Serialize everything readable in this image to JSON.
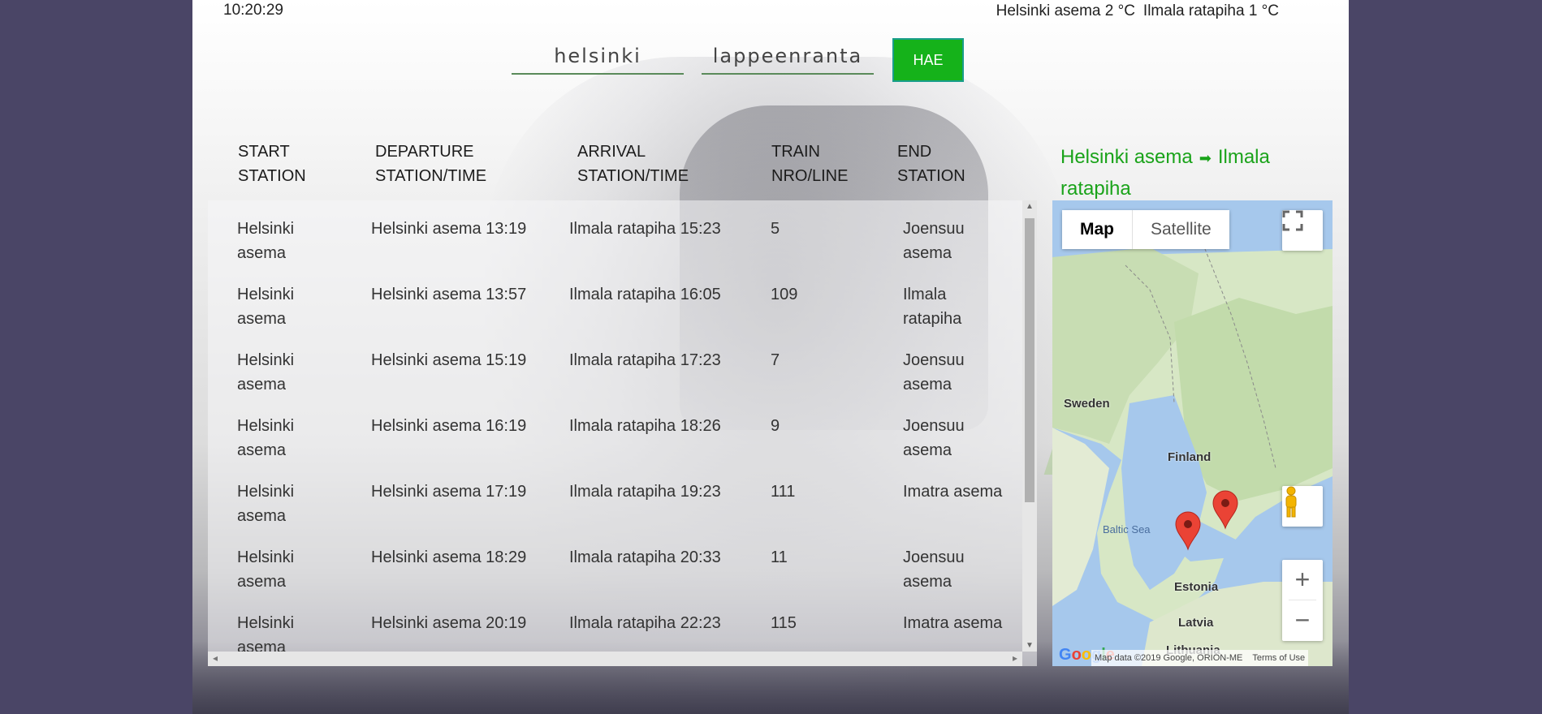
{
  "header": {
    "clock": "10:20:29",
    "weather": [
      {
        "text": "Helsinki asema 2 °C"
      },
      {
        "text": "Ilmala ratapiha 1 °C"
      }
    ]
  },
  "search": {
    "from_value": "helsinki",
    "to_value": "lappeenranta",
    "button_label": "HAE"
  },
  "route": {
    "from": "Helsinki asema",
    "arrow": "➡",
    "to": "Ilmala ratapiha"
  },
  "table": {
    "headers": [
      {
        "line1": "START",
        "line2": "STATION"
      },
      {
        "line1": "DEPARTURE",
        "line2": "STATION/TIME"
      },
      {
        "line1": "ARRIVAL",
        "line2": "STATION/TIME"
      },
      {
        "line1": "TRAIN",
        "line2": "NRO/LINE"
      },
      {
        "line1": "END",
        "line2": "STATION"
      }
    ],
    "rows": [
      {
        "start": "Helsinki asema",
        "departure": "Helsinki asema 13:19",
        "arrival": "Ilmala ratapiha 15:23",
        "train": "5",
        "end": "Joensuu asema"
      },
      {
        "start": "Helsinki asema",
        "departure": "Helsinki asema 13:57",
        "arrival": "Ilmala ratapiha 16:05",
        "train": "109",
        "end": "Ilmala ratapiha"
      },
      {
        "start": "Helsinki asema",
        "departure": "Helsinki asema 15:19",
        "arrival": "Ilmala ratapiha 17:23",
        "train": "7",
        "end": "Joensuu asema"
      },
      {
        "start": "Helsinki asema",
        "departure": "Helsinki asema 16:19",
        "arrival": "Ilmala ratapiha 18:26",
        "train": "9",
        "end": "Joensuu asema"
      },
      {
        "start": "Helsinki asema",
        "departure": "Helsinki asema 17:19",
        "arrival": "Ilmala ratapiha 19:23",
        "train": "111",
        "end": "Imatra asema"
      },
      {
        "start": "Helsinki asema",
        "departure": "Helsinki asema 18:29",
        "arrival": "Ilmala ratapiha 20:33",
        "train": "11",
        "end": "Joensuu asema"
      },
      {
        "start": "Helsinki asema",
        "departure": "Helsinki asema 20:19",
        "arrival": "Ilmala ratapiha 22:23",
        "train": "115",
        "end": "Imatra asema"
      }
    ]
  },
  "map": {
    "type_buttons": {
      "map": "Map",
      "satellite": "Satellite"
    },
    "labels": {
      "sweden": "Sweden",
      "finland": "Finland",
      "baltic": "Baltic Sea",
      "estonia": "Estonia",
      "latvia": "Latvia",
      "lithuania": "Lithuania"
    },
    "attribution": "Map data ©2019 Google, ORION-ME",
    "terms": "Terms of Use",
    "logo": "Google",
    "zoom_in": "+",
    "zoom_out": "−",
    "colors": {
      "water": "#a6c8ec",
      "land": "#e6ecd8",
      "forest": "#cfe2bf",
      "marker": "#ea4335"
    }
  },
  "colors": {
    "accent": "#15b21a",
    "route_text": "#1aa31a",
    "background": "#4a4566"
  }
}
